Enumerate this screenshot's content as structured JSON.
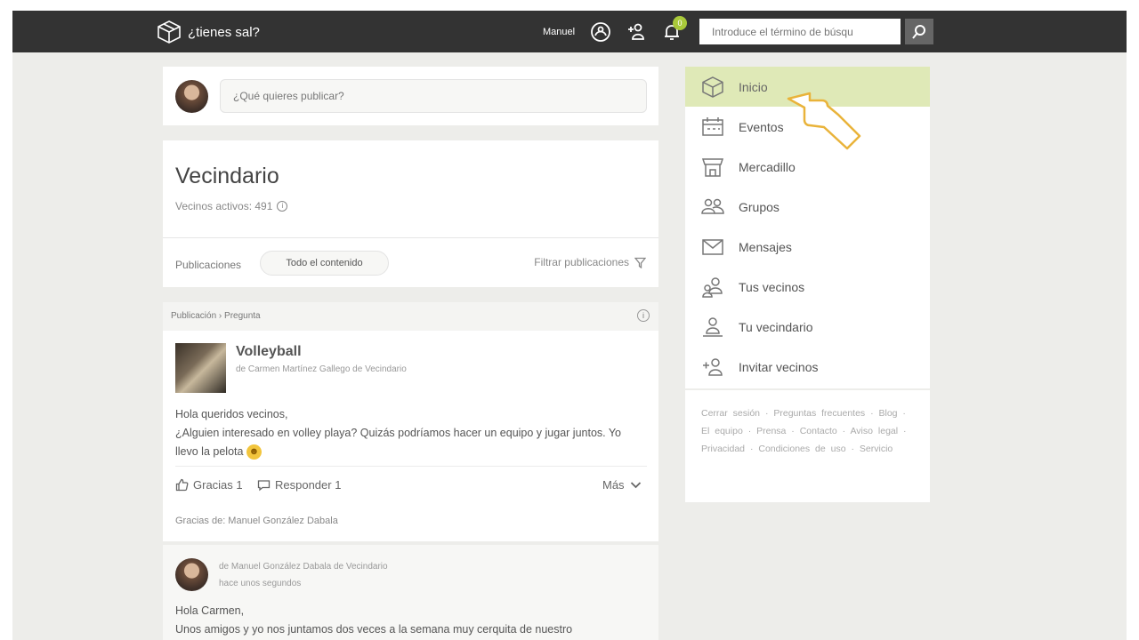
{
  "header": {
    "logo_text": "¿tienes sal?",
    "user_name": "Manuel",
    "notification_count": "0",
    "search_placeholder": "Introduce el término de búsqu"
  },
  "composer": {
    "placeholder": "¿Qué quieres publicar?"
  },
  "neighborhood": {
    "title": "Vecindario",
    "active_label": "Vecinos activos: 491",
    "pubs_label": "Publicaciones",
    "filter_pill": "Todo el contenido",
    "filter_link": "Filtrar publicaciones"
  },
  "post": {
    "header": "Publicación › Pregunta",
    "title": "Volleyball",
    "author": "de Carmen Martínez Gallego de Vecindario",
    "body_line1": "Hola queridos vecinos,",
    "body_line2": "¿Alguien interesado en volley playa? Quizás podríamos hacer un equipo y jugar juntos. Yo llevo la pelota",
    "thanks_label": "Gracias 1",
    "reply_label": "Responder 1",
    "more_label": "Más",
    "thanks_line": "Gracias de: Manuel González Dabala"
  },
  "reply": {
    "author": "de Manuel González Dabala de Vecindario",
    "time": "hace unos segundos",
    "body_line1": "Hola Carmen,",
    "body_line2": "Unos amigos y yo nos juntamos dos veces a la semana muy cerquita de nuestro"
  },
  "sidebar": {
    "items": [
      {
        "label": "Inicio",
        "icon": "home-cube-icon"
      },
      {
        "label": "Eventos",
        "icon": "calendar-icon"
      },
      {
        "label": "Mercadillo",
        "icon": "market-stall-icon"
      },
      {
        "label": "Grupos",
        "icon": "group-icon"
      },
      {
        "label": "Mensajes",
        "icon": "envelope-icon"
      },
      {
        "label": "Tus vecinos",
        "icon": "neighbors-icon"
      },
      {
        "label": "Tu vecindario",
        "icon": "neighborhood-icon"
      },
      {
        "label": "Invitar vecinos",
        "icon": "add-user-icon"
      }
    ],
    "links_text": "Cerrar sesión · Preguntas frecuentes · Blog · El equipo · Prensa · Contacto · Aviso legal · Privacidad · Condiciones de uso · Servicio"
  },
  "colors": {
    "topbar": "#333333",
    "active_nav": "#dfe9b7",
    "badge": "#a9c93a",
    "background": "#ededea"
  }
}
